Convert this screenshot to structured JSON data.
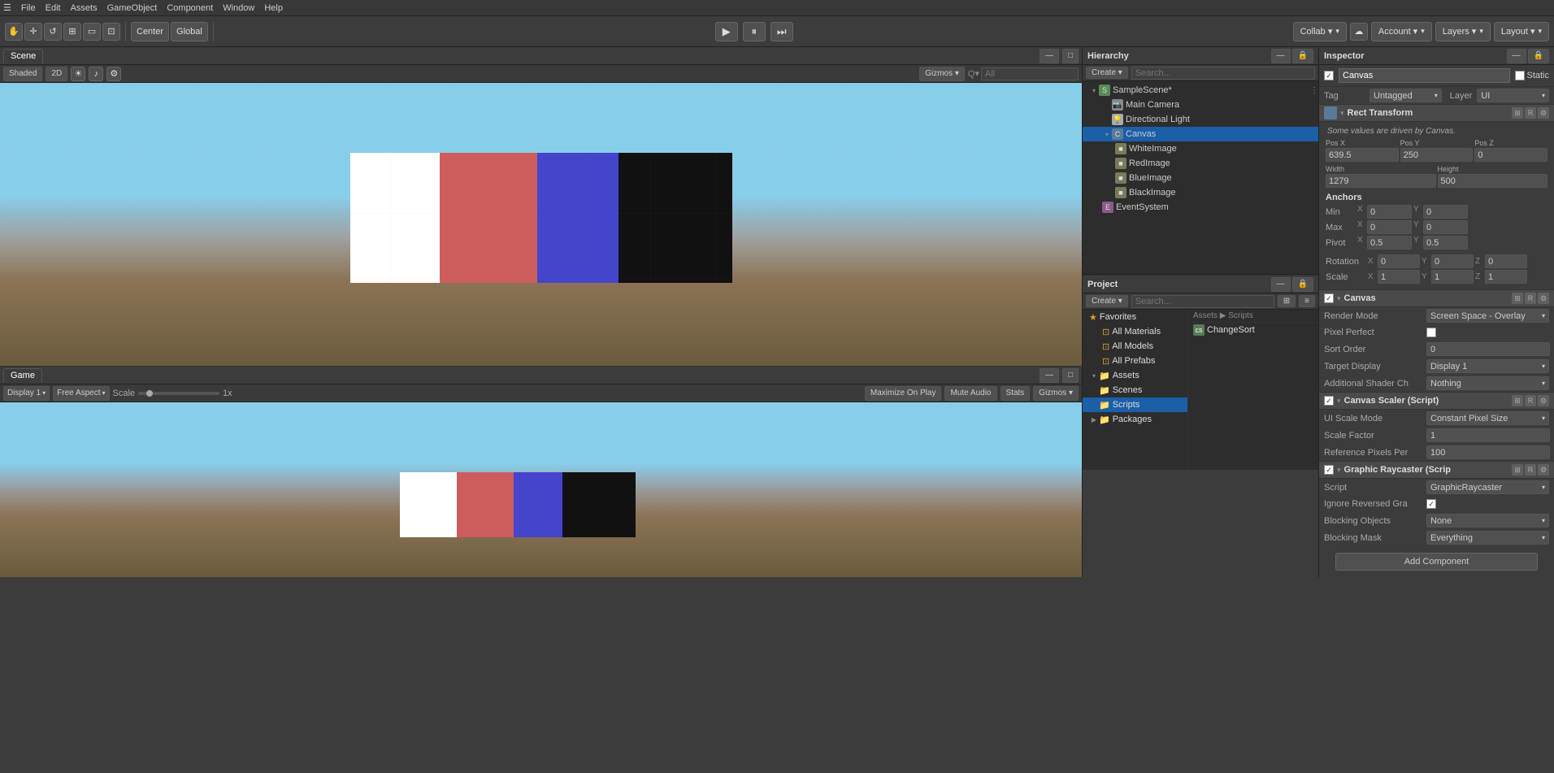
{
  "menubar": {
    "items": [
      "File",
      "Edit",
      "Assets",
      "GameObject",
      "Component",
      "Window",
      "Help"
    ]
  },
  "toolbar": {
    "center_label": "Center",
    "global_label": "Global",
    "collab_label": "Collab ▾",
    "account_label": "Account ▾",
    "layers_label": "Layers ▾",
    "layout_label": "Layout ▾"
  },
  "scene": {
    "tab_label": "Scene",
    "shading_label": "Shaded",
    "gizmos_label": "Gizmos ▾",
    "search_placeholder": "All",
    "colors": [
      "#ffffff",
      "#cd5c5c",
      "#4444cc",
      "#111111"
    ],
    "widths": [
      110,
      120,
      100,
      140
    ]
  },
  "game": {
    "tab_label": "Game",
    "display_label": "Display 1",
    "aspect_label": "Free Aspect",
    "scale_label": "Scale",
    "scale_value": "1x",
    "maximize_label": "Maximize On Play",
    "mute_label": "Mute Audio",
    "stats_label": "Stats",
    "gizmos_label": "Gizmos ▾",
    "colors": [
      "#ffffff",
      "#cd5c5c",
      "#4444cc",
      "#111111"
    ],
    "widths": [
      70,
      70,
      60,
      90
    ]
  },
  "hierarchy": {
    "tab_label": "Hierarchy",
    "create_label": "Create ▾",
    "scene_name": "SampleScene*",
    "items": [
      {
        "label": "Main Camera",
        "indent": 2,
        "type": "camera"
      },
      {
        "label": "Directional Light",
        "indent": 2,
        "type": "light"
      },
      {
        "label": "Canvas",
        "indent": 2,
        "type": "canvas",
        "selected": true
      },
      {
        "label": "WhiteImage",
        "indent": 3,
        "type": "obj"
      },
      {
        "label": "RedImage",
        "indent": 3,
        "type": "obj"
      },
      {
        "label": "BlueImage",
        "indent": 3,
        "type": "obj"
      },
      {
        "label": "BlackImage",
        "indent": 3,
        "type": "obj"
      },
      {
        "label": "EventSystem",
        "indent": 2,
        "type": "event"
      }
    ]
  },
  "project": {
    "tab_label": "Project",
    "create_label": "Create ▾",
    "favorites": {
      "label": "Favorites",
      "items": [
        "All Materials",
        "All Models",
        "All Prefabs"
      ]
    },
    "assets": {
      "label": "Assets",
      "items": [
        "Scenes",
        "Scripts"
      ]
    },
    "packages": {
      "label": "Packages"
    },
    "file_label": "ChangeSort",
    "assets_path": "Assets ▶ Scripts"
  },
  "inspector": {
    "tab_label": "Inspector",
    "game_object_name": "Canvas",
    "static_label": "Static",
    "tag_label": "Tag",
    "tag_value": "Untagged",
    "layer_label": "Layer",
    "layer_value": "UI",
    "rect_transform": {
      "title": "Rect Transform",
      "note": "Some values are driven by Canvas.",
      "pos_x_label": "Pos X",
      "pos_y_label": "Pos Y",
      "pos_z_label": "Pos Z",
      "pos_x_value": "639.5",
      "pos_y_value": "250",
      "pos_z_value": "0",
      "width_label": "Width",
      "height_label": "Height",
      "width_value": "1279",
      "height_value": "500",
      "anchors_label": "Anchors",
      "min_label": "Min",
      "max_label": "Max",
      "pivot_label": "Pivot",
      "min_x": "0",
      "min_y": "0",
      "max_x": "0",
      "max_y": "0",
      "pivot_x": "0.5",
      "pivot_y": "0.5",
      "rotation_label": "Rotation",
      "scale_label": "Scale",
      "rot_x": "0",
      "rot_y": "0",
      "rot_z": "0",
      "scale_x": "1",
      "scale_y": "1",
      "scale_z": "1"
    },
    "canvas": {
      "title": "Canvas",
      "render_mode_label": "Render Mode",
      "render_mode_value": "Screen Space - Overlay",
      "pixel_perfect_label": "Pixel Perfect",
      "sort_order_label": "Sort Order",
      "sort_order_value": "0",
      "target_display_label": "Target Display",
      "target_display_value": "Display 1",
      "additional_shader_label": "Additional Shader Ch",
      "additional_shader_value": "Nothing"
    },
    "canvas_scaler": {
      "title": "Canvas Scaler (Script)",
      "ui_scale_mode_label": "UI Scale Mode",
      "ui_scale_mode_value": "Constant Pixel Size",
      "scale_factor_label": "Scale Factor",
      "scale_factor_value": "1",
      "reference_pixels_label": "Reference Pixels Per",
      "reference_pixels_value": "100"
    },
    "graphic_raycaster": {
      "title": "Graphic Raycaster (Scrip",
      "script_label": "Script",
      "script_value": "GraphicRaycaster",
      "ignore_reversed_label": "Ignore Reversed Gra",
      "blocking_objects_label": "Blocking Objects",
      "blocking_objects_value": "None",
      "blocking_mask_label": "Blocking Mask",
      "blocking_mask_value": "Everything"
    },
    "add_component_label": "Add Component"
  }
}
